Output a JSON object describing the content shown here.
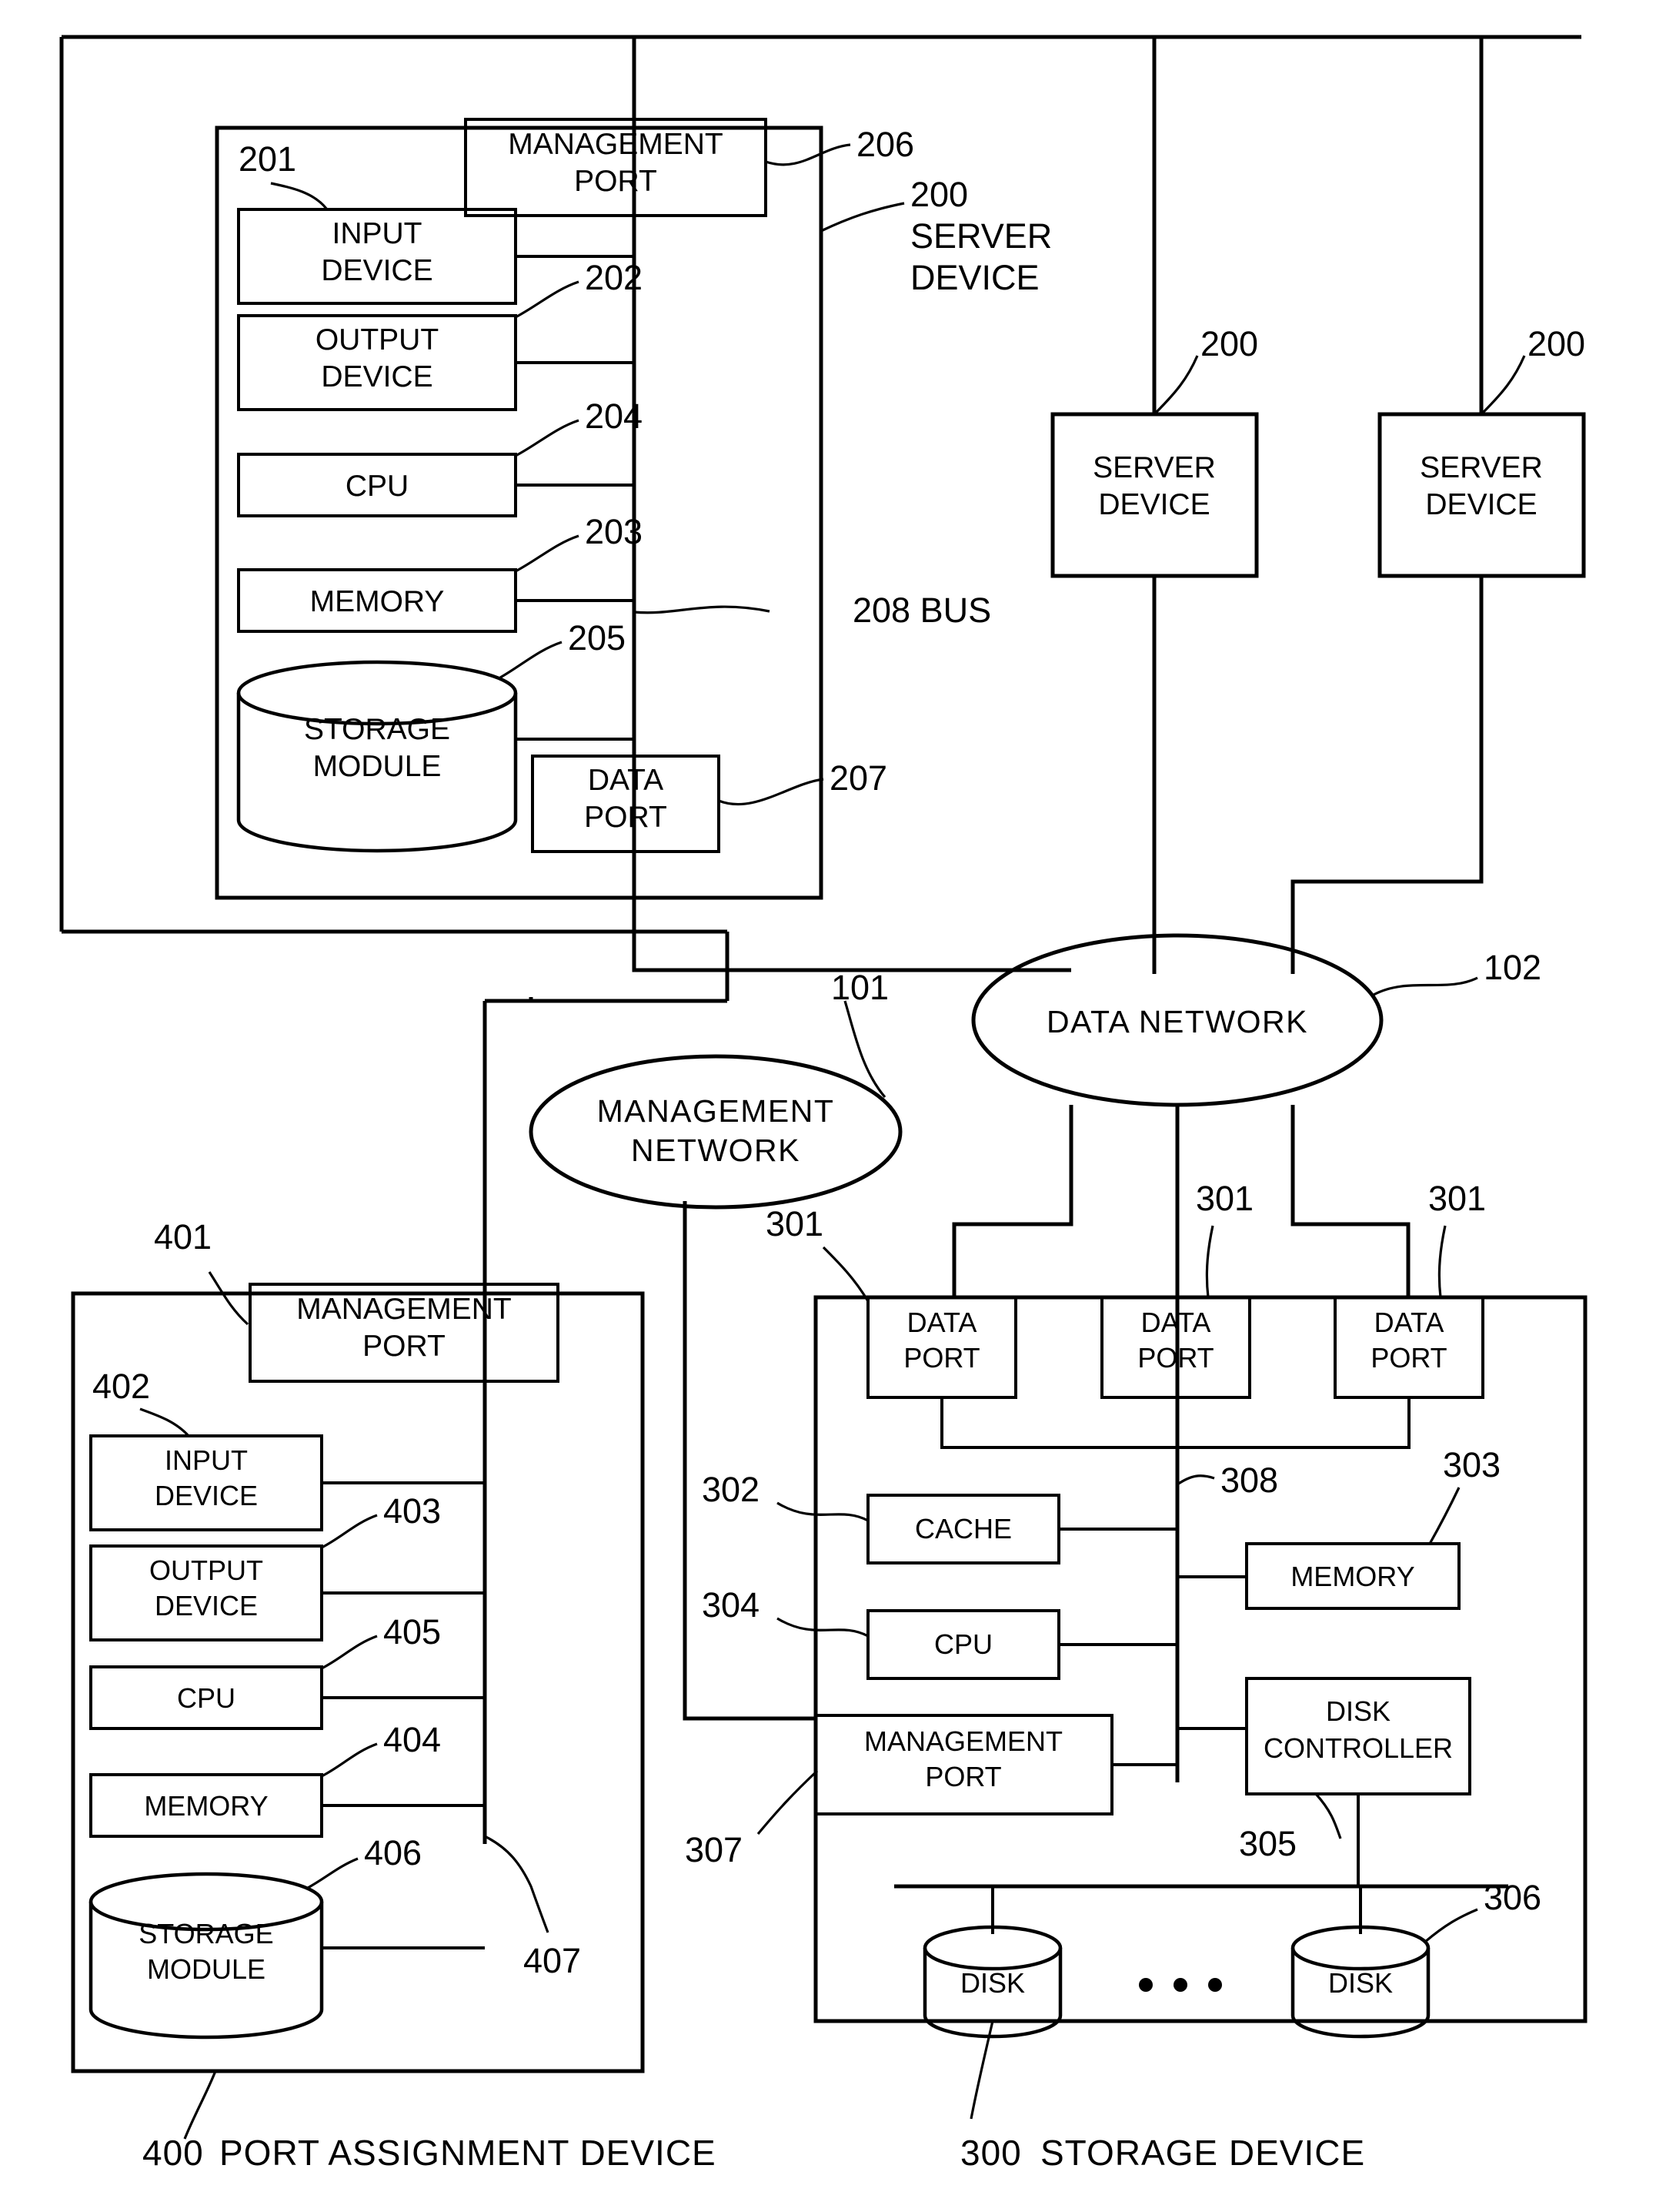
{
  "diagram": {
    "title_free_text": "",
    "server_device": {
      "outer_label_num": "200",
      "outer_label_line1": "SERVER",
      "outer_label_line2": "DEVICE",
      "bus_label": "208 BUS",
      "components": [
        {
          "num": "206",
          "line1": "MANAGEMENT",
          "line2": "PORT",
          "name": "management-port"
        },
        {
          "num": "201",
          "line1": "INPUT",
          "line2": "DEVICE",
          "name": "input-device"
        },
        {
          "num": "202",
          "line1": "OUTPUT",
          "line2": "DEVICE",
          "name": "output-device"
        },
        {
          "num": "204",
          "line1": "CPU",
          "line2": "",
          "name": "cpu"
        },
        {
          "num": "203",
          "line1": "MEMORY",
          "line2": "",
          "name": "memory"
        },
        {
          "num": "205",
          "line1": "STORAGE",
          "line2": "MODULE",
          "name": "storage-module"
        },
        {
          "num": "207",
          "line1": "DATA",
          "line2": "PORT",
          "name": "data-port"
        }
      ]
    },
    "extra_servers": [
      {
        "num": "200",
        "line1": "SERVER",
        "line2": "DEVICE"
      },
      {
        "num": "200",
        "line1": "SERVER",
        "line2": "DEVICE"
      }
    ],
    "networks": [
      {
        "num": "101",
        "line1": "MANAGEMENT",
        "line2": "NETWORK",
        "name": "management-network"
      },
      {
        "num": "102",
        "line1": "DATA  NETWORK",
        "line2": "",
        "name": "data-network"
      }
    ],
    "port_assignment_device": {
      "caption_num": "400",
      "caption_text": "PORT  ASSIGNMENT  DEVICE",
      "bus_num": "407",
      "components": [
        {
          "num": "401",
          "line1": "MANAGEMENT",
          "line2": "PORT",
          "name": "management-port"
        },
        {
          "num": "402",
          "line1": "INPUT",
          "line2": "DEVICE",
          "name": "input-device"
        },
        {
          "num": "403",
          "line1": "OUTPUT",
          "line2": "DEVICE",
          "name": "output-device"
        },
        {
          "num": "405",
          "line1": "CPU",
          "line2": "",
          "name": "cpu"
        },
        {
          "num": "404",
          "line1": "MEMORY",
          "line2": "",
          "name": "memory"
        },
        {
          "num": "406",
          "line1": "STORAGE",
          "line2": "MODULE",
          "name": "storage-module"
        }
      ]
    },
    "storage_device": {
      "caption_num": "300",
      "caption_text": "STORAGE  DEVICE",
      "bus_num": "308",
      "disk_bus_num": "305",
      "data_ports": [
        {
          "num": "301",
          "line1": "DATA",
          "line2": "PORT"
        },
        {
          "num": "301",
          "line1": "DATA",
          "line2": "PORT"
        },
        {
          "num": "301",
          "line1": "DATA",
          "line2": "PORT"
        }
      ],
      "components": [
        {
          "num": "302",
          "line1": "CACHE",
          "line2": "",
          "name": "cache"
        },
        {
          "num": "303",
          "line1": "MEMORY",
          "line2": "",
          "name": "memory"
        },
        {
          "num": "304",
          "line1": "CPU",
          "line2": "",
          "name": "cpu"
        },
        {
          "num": "307",
          "line1": "MANAGEMENT",
          "line2": "PORT",
          "name": "management-port"
        },
        {
          "num": "305",
          "line1": "DISK",
          "line2": "CONTROLLER",
          "name": "disk-controller"
        }
      ],
      "disks": [
        {
          "num": "",
          "label": "DISK"
        },
        {
          "num": "306",
          "label": "DISK"
        }
      ],
      "ellipsis": "• • •"
    }
  }
}
